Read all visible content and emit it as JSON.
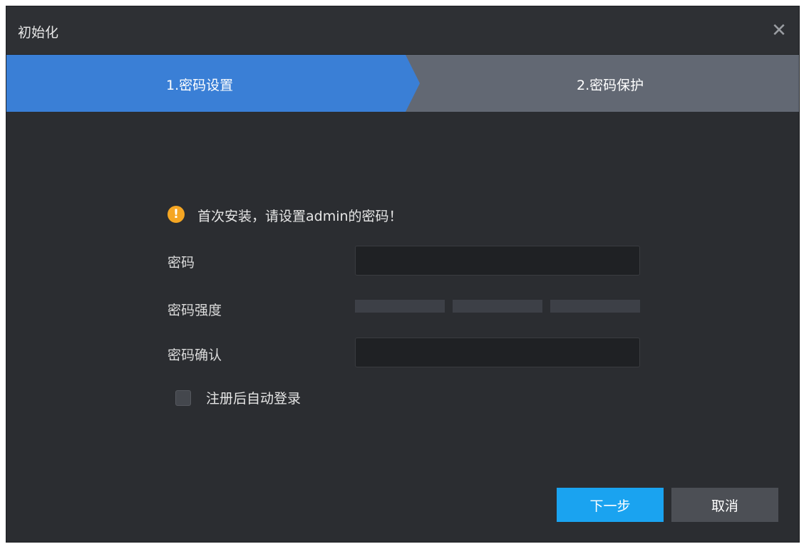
{
  "window": {
    "title": "初始化",
    "close_glyph": "✕"
  },
  "steps": [
    {
      "label": "1.密码设置",
      "active": true
    },
    {
      "label": "2.密码保护",
      "active": false
    }
  ],
  "colors": {
    "active_step": "#3a7fd6",
    "inactive_step": "#626873",
    "primary_button": "#1aa3f0",
    "warning_icon": "#f5a623",
    "background": "#2b2d31"
  },
  "warning": {
    "icon_glyph": "!",
    "text": "首次安装，请设置admin的密码！"
  },
  "form": {
    "password_label": "密码",
    "password_value": "",
    "strength_label": "密码强度",
    "confirm_label": "密码确认",
    "confirm_value": "",
    "auto_login_label": "注册后自动登录",
    "auto_login_checked": false
  },
  "buttons": {
    "next": "下一步",
    "cancel": "取消"
  }
}
